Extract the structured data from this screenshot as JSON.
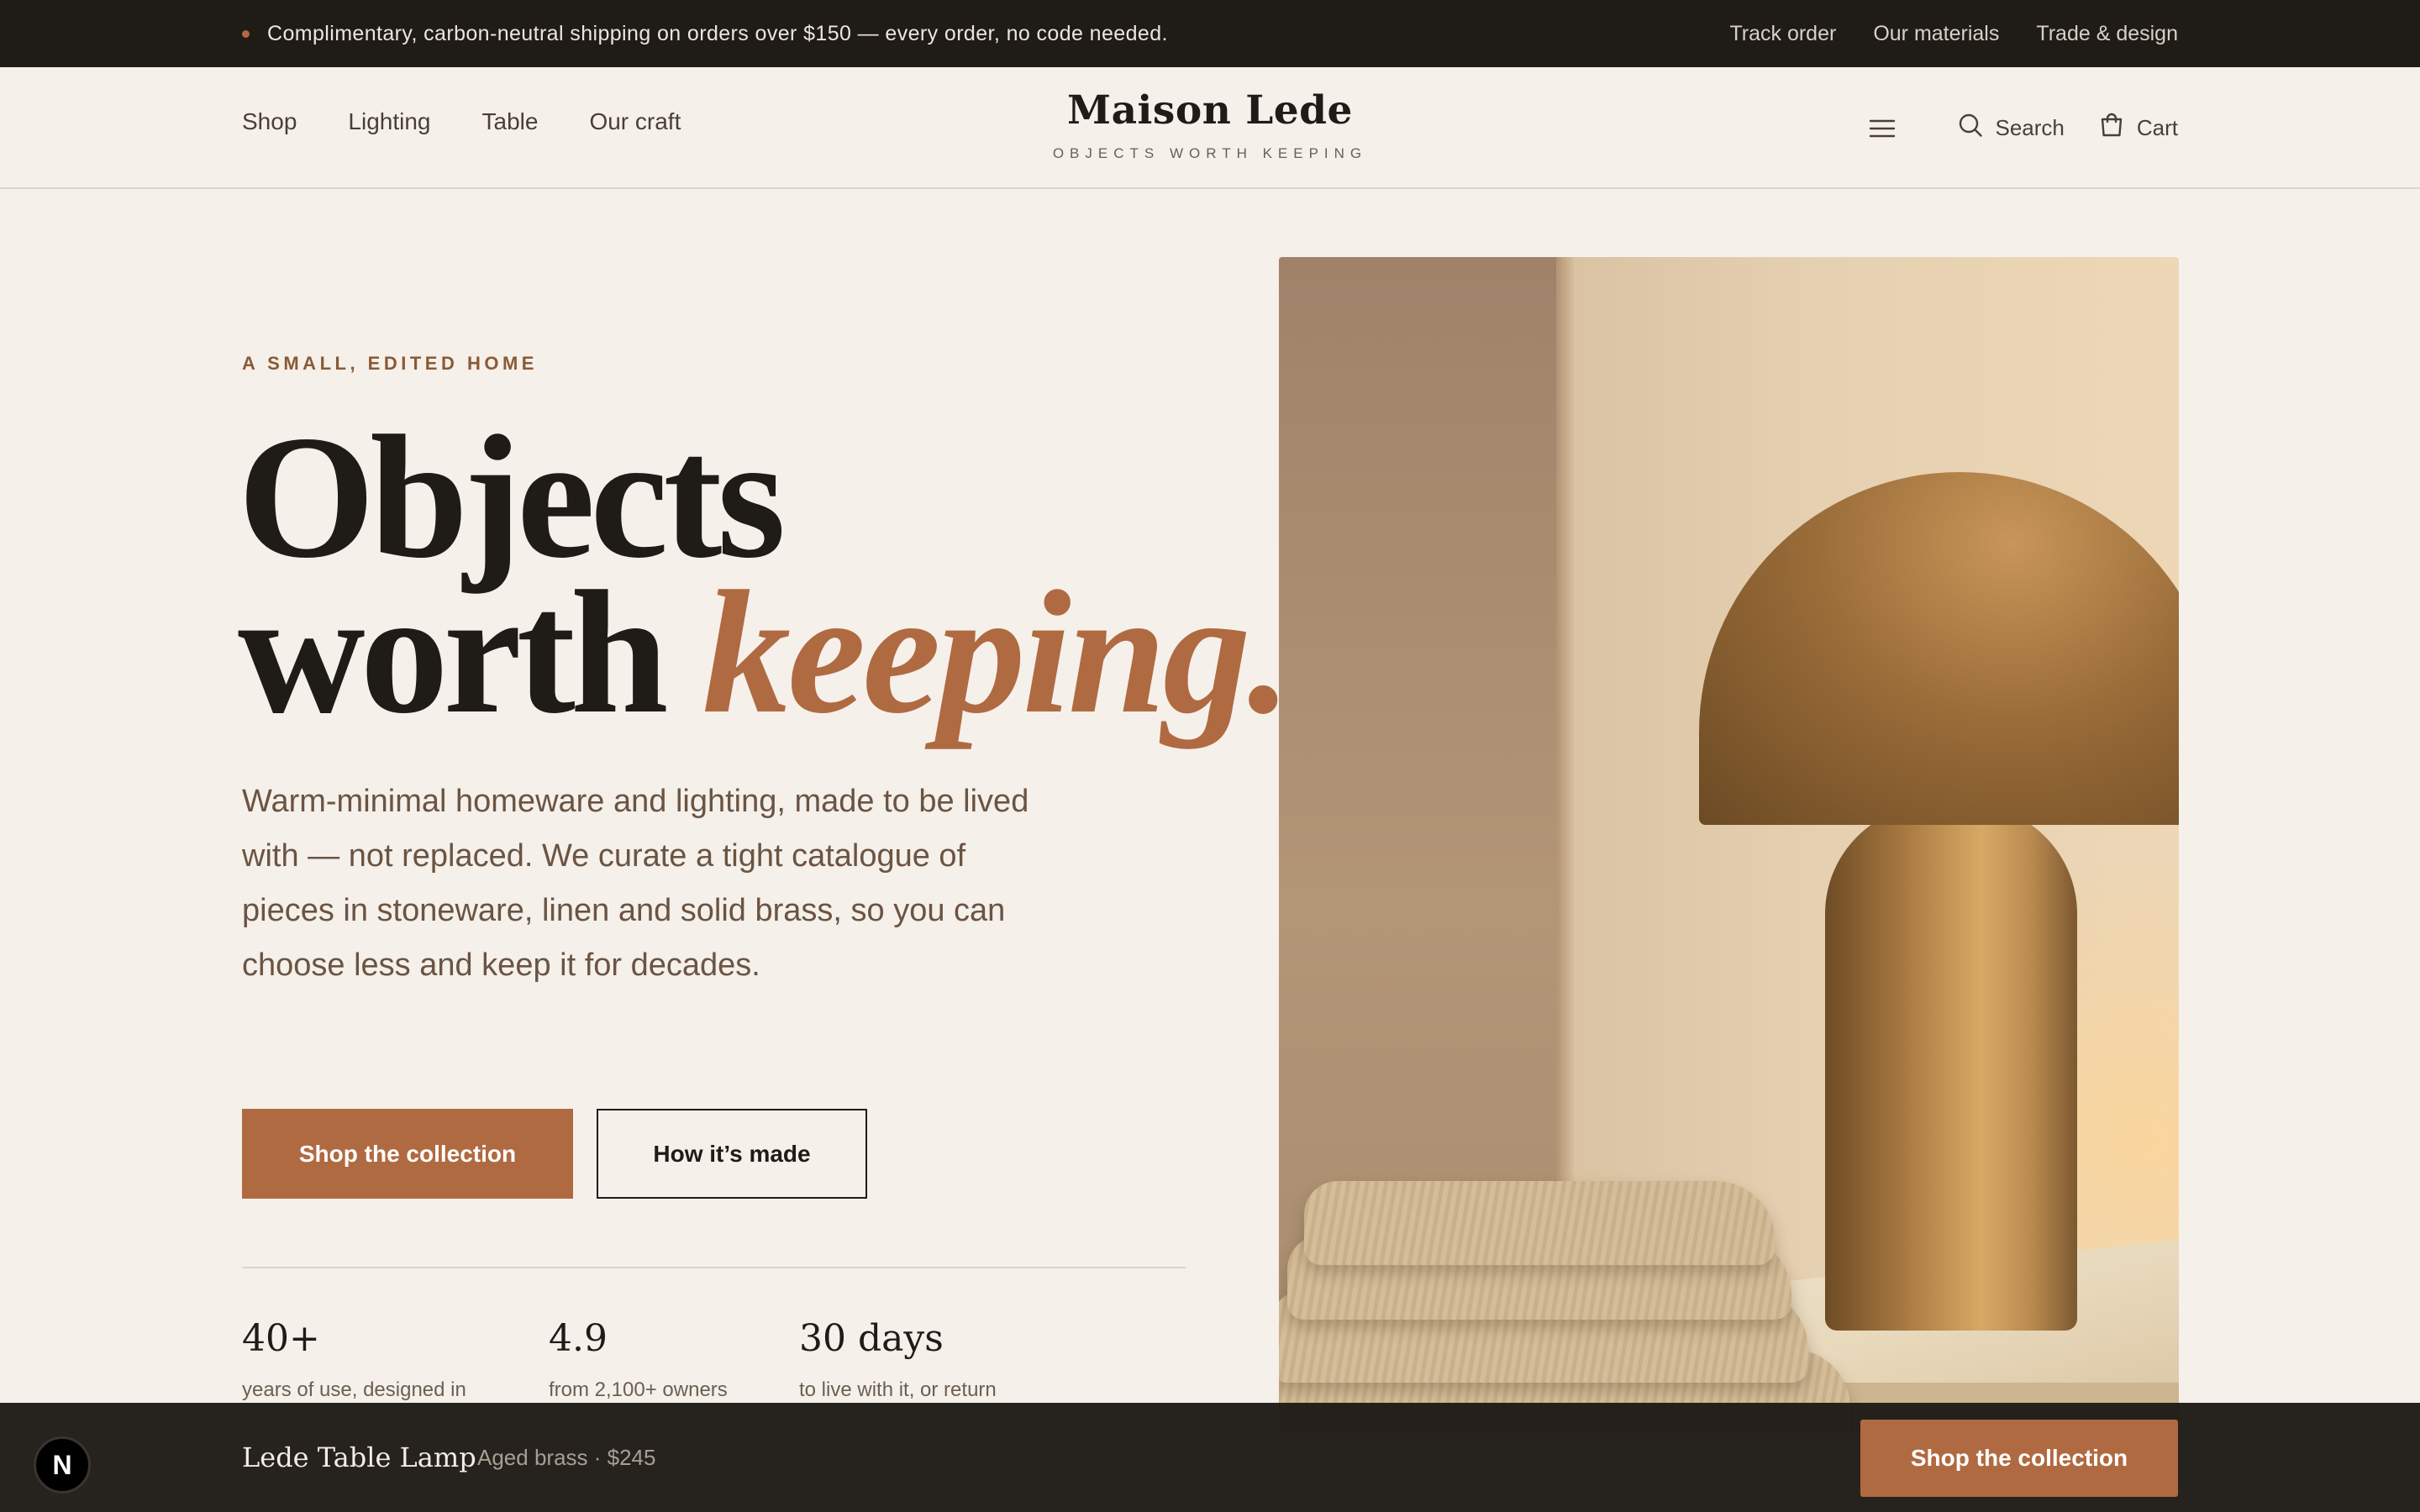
{
  "announcement": {
    "text": "Complimentary, carbon-neutral shipping on orders over $150 — every order, no code needed.",
    "links": [
      "Track order",
      "Our materials",
      "Trade & design"
    ]
  },
  "header": {
    "nav": [
      "Shop",
      "Lighting",
      "Table",
      "Our craft"
    ],
    "brand_name": "Maison Lede",
    "brand_tagline": "OBJECTS WORTH KEEPING",
    "search_label": "Search",
    "cart_label": "Cart",
    "icons": [
      "menu-icon",
      "search-icon",
      "cart-icon"
    ]
  },
  "hero": {
    "eyebrow": "A SMALL, EDITED HOME",
    "headline_line1": "Objects",
    "headline_line2_plain": "worth",
    "headline_line2_accent": "keeping.",
    "lede": "Warm-minimal homeware and lighting, made to be lived with — not replaced. We curate a tight catalogue of pieces in stoneware, linen and solid brass, so you can choose less and keep it for decades.",
    "primary_cta": "Shop the collection",
    "secondary_cta": "How it’s made",
    "stats": [
      {
        "value": "40+",
        "label": "years of use, designed in"
      },
      {
        "value": "4.9",
        "label": "from 2,100+ owners"
      },
      {
        "value": "30 days",
        "label": "to live with it, or return"
      }
    ]
  },
  "sticky_bar": {
    "badge": "N",
    "product_name": "Lede Table Lamp",
    "product_meta": "Aged brass · $245",
    "cta": "Shop the collection"
  },
  "colors": {
    "background": "#f5f0ea",
    "dark": "#1f1b17",
    "accent": "#b06a41",
    "eyebrow": "#8a5a34"
  }
}
